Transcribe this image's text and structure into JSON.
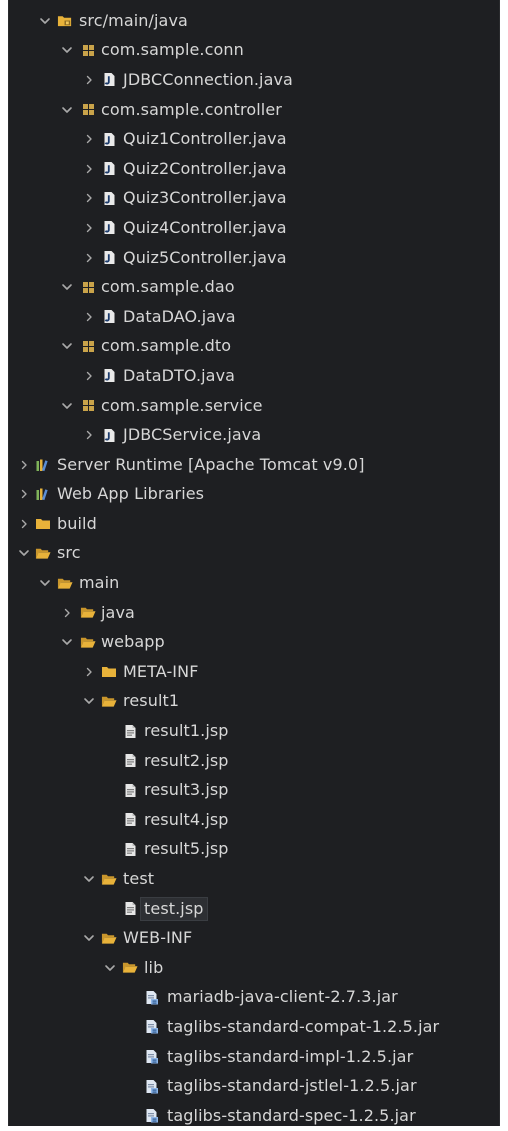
{
  "tree": [
    {
      "label": "src/main/java",
      "depth": 1,
      "chevron": "down",
      "icon": "package-folder-icon"
    },
    {
      "label": "com.sample.conn",
      "depth": 2,
      "chevron": "down",
      "icon": "package-icon"
    },
    {
      "label": "JDBCConnection.java",
      "depth": 3,
      "chevron": "right",
      "icon": "java-file-icon"
    },
    {
      "label": "com.sample.controller",
      "depth": 2,
      "chevron": "down",
      "icon": "package-icon"
    },
    {
      "label": "Quiz1Controller.java",
      "depth": 3,
      "chevron": "right",
      "icon": "java-file-icon"
    },
    {
      "label": "Quiz2Controller.java",
      "depth": 3,
      "chevron": "right",
      "icon": "java-file-icon"
    },
    {
      "label": "Quiz3Controller.java",
      "depth": 3,
      "chevron": "right",
      "icon": "java-file-icon"
    },
    {
      "label": "Quiz4Controller.java",
      "depth": 3,
      "chevron": "right",
      "icon": "java-file-icon"
    },
    {
      "label": "Quiz5Controller.java",
      "depth": 3,
      "chevron": "right",
      "icon": "java-file-icon"
    },
    {
      "label": "com.sample.dao",
      "depth": 2,
      "chevron": "down",
      "icon": "package-icon"
    },
    {
      "label": "DataDAO.java",
      "depth": 3,
      "chevron": "right",
      "icon": "java-file-icon"
    },
    {
      "label": "com.sample.dto",
      "depth": 2,
      "chevron": "down",
      "icon": "package-icon"
    },
    {
      "label": "DataDTO.java",
      "depth": 3,
      "chevron": "right",
      "icon": "java-file-icon"
    },
    {
      "label": "com.sample.service",
      "depth": 2,
      "chevron": "down",
      "icon": "package-icon"
    },
    {
      "label": "JDBCService.java",
      "depth": 3,
      "chevron": "right",
      "icon": "java-file-icon"
    },
    {
      "label": "Server Runtime [Apache Tomcat v9.0]",
      "depth": 0,
      "chevron": "right",
      "icon": "library-icon"
    },
    {
      "label": "Web App Libraries",
      "depth": 0,
      "chevron": "right",
      "icon": "library-icon"
    },
    {
      "label": "build",
      "depth": 0,
      "chevron": "right",
      "icon": "folder-icon"
    },
    {
      "label": "src",
      "depth": 0,
      "chevron": "down",
      "icon": "folder-open-icon"
    },
    {
      "label": "main",
      "depth": 1,
      "chevron": "down",
      "icon": "folder-open-icon"
    },
    {
      "label": "java",
      "depth": 2,
      "chevron": "right",
      "icon": "folder-open-icon"
    },
    {
      "label": "webapp",
      "depth": 2,
      "chevron": "down",
      "icon": "folder-open-icon"
    },
    {
      "label": "META-INF",
      "depth": 3,
      "chevron": "right",
      "icon": "folder-icon"
    },
    {
      "label": "result1",
      "depth": 3,
      "chevron": "down",
      "icon": "folder-open-icon"
    },
    {
      "label": "result1.jsp",
      "depth": 4,
      "chevron": "none",
      "icon": "jsp-file-icon"
    },
    {
      "label": "result2.jsp",
      "depth": 4,
      "chevron": "none",
      "icon": "jsp-file-icon"
    },
    {
      "label": "result3.jsp",
      "depth": 4,
      "chevron": "none",
      "icon": "jsp-file-icon"
    },
    {
      "label": "result4.jsp",
      "depth": 4,
      "chevron": "none",
      "icon": "jsp-file-icon"
    },
    {
      "label": "result5.jsp",
      "depth": 4,
      "chevron": "none",
      "icon": "jsp-file-icon"
    },
    {
      "label": "test",
      "depth": 3,
      "chevron": "down",
      "icon": "folder-open-icon"
    },
    {
      "label": "test.jsp",
      "depth": 4,
      "chevron": "none",
      "icon": "jsp-file-icon",
      "selected": true
    },
    {
      "label": "WEB-INF",
      "depth": 3,
      "chevron": "down",
      "icon": "folder-open-icon"
    },
    {
      "label": "lib",
      "depth": 4,
      "chevron": "down",
      "icon": "folder-open-icon"
    },
    {
      "label": "mariadb-java-client-2.7.3.jar",
      "depth": 5,
      "chevron": "none",
      "icon": "jar-file-icon"
    },
    {
      "label": "taglibs-standard-compat-1.2.5.jar",
      "depth": 5,
      "chevron": "none",
      "icon": "jar-file-icon"
    },
    {
      "label": "taglibs-standard-impl-1.2.5.jar",
      "depth": 5,
      "chevron": "none",
      "icon": "jar-file-icon"
    },
    {
      "label": "taglibs-standard-jstlel-1.2.5.jar",
      "depth": 5,
      "chevron": "none",
      "icon": "jar-file-icon"
    },
    {
      "label": "taglibs-standard-spec-1.2.5.jar",
      "depth": 5,
      "chevron": "none",
      "icon": "jar-file-icon"
    }
  ],
  "colors": {
    "background": "#1e1f22",
    "text": "#d7d7d7",
    "chevron": "#a9a9a9",
    "folder": "#e8b23a",
    "package": "#c9a34a",
    "java_file": "#e9e9e9",
    "jar": "#8fb6e8"
  }
}
